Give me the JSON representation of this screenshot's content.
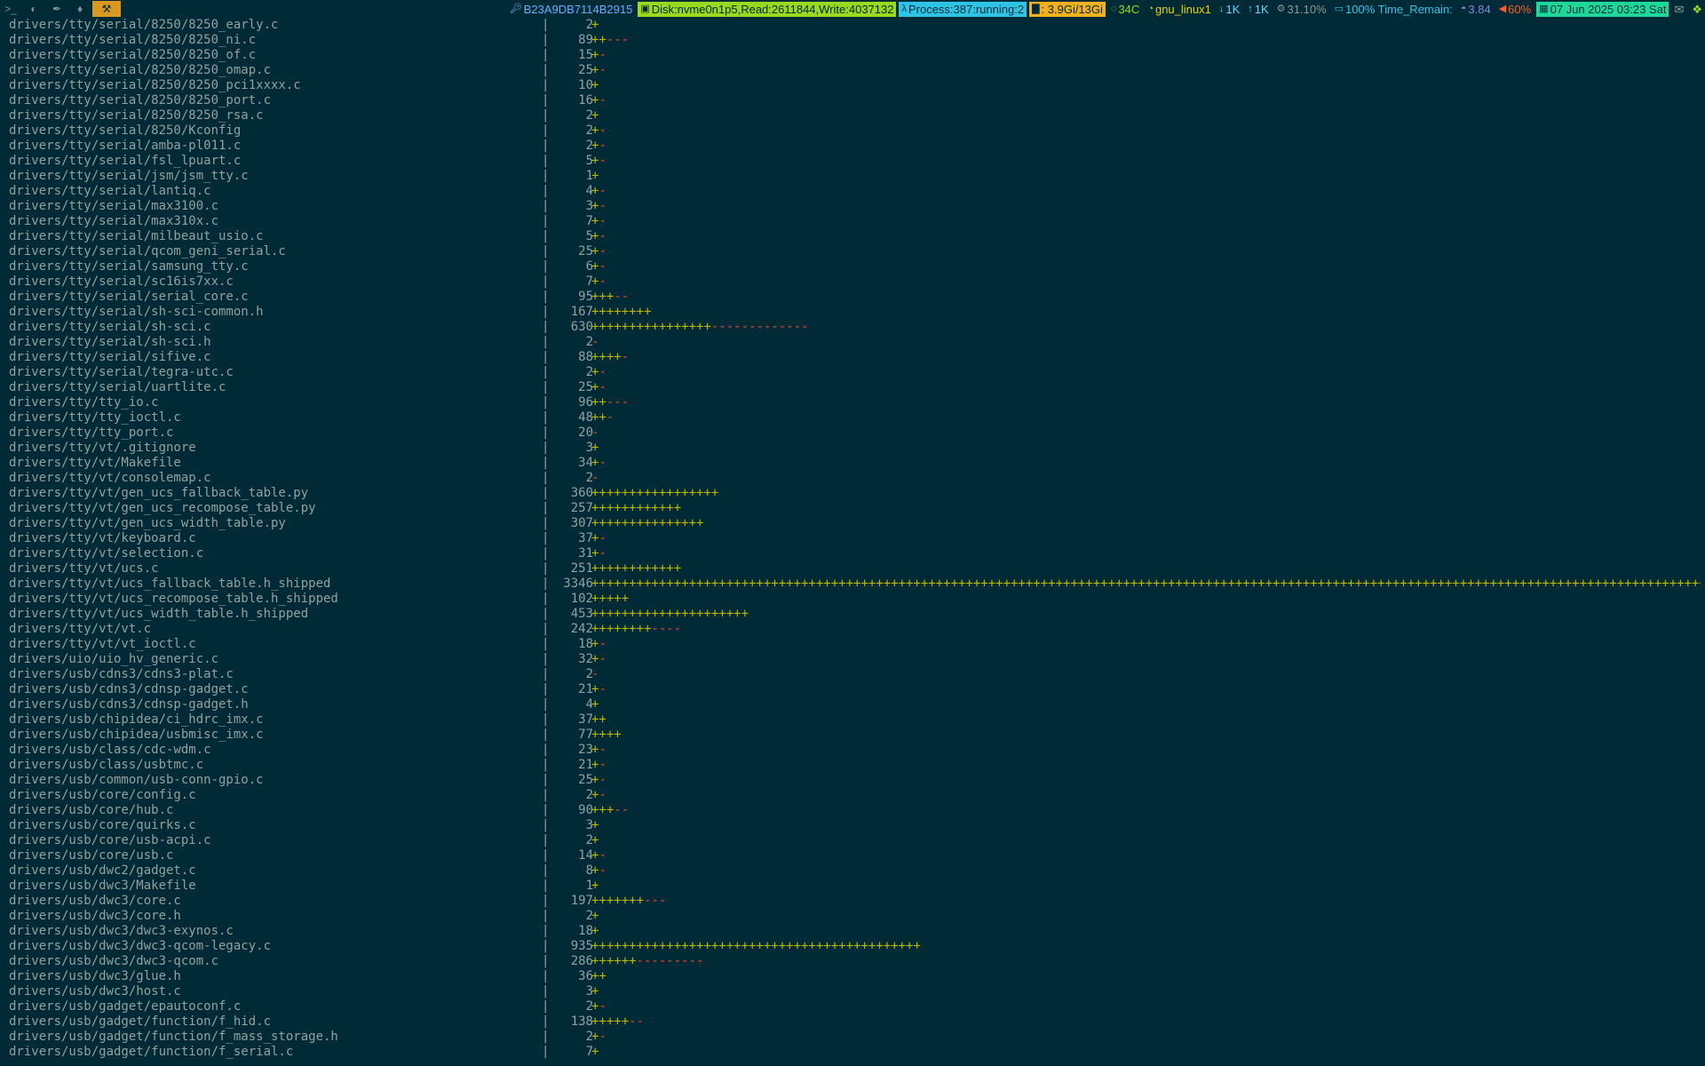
{
  "statusbar": {
    "workspaces": [
      {
        "name": "terminal-icon",
        "glyph": ">_"
      },
      {
        "name": "firefox-icon",
        "glyph": "◐"
      },
      {
        "name": "feather-icon",
        "glyph": "✒"
      },
      {
        "name": "penguin-icon",
        "glyph": "♦"
      },
      {
        "name": "tools-icon",
        "glyph": "⚒"
      }
    ],
    "host": "B23A9DB7114B2915",
    "disk": "Disk:nvme0n1p5,Read:2611844,Write:4037132",
    "process": "Process:387:running:2",
    "memory": ": 3.9Gi/13Gi",
    "temperature": "34C",
    "wifi": "gnu_linux1",
    "net_down": "1K",
    "net_up": "1K",
    "cpu": "31.10%",
    "battery": "100% Time_Remain:",
    "load": "3.84",
    "volume": "60%",
    "datetime": "07 Jun 2025 03:23 Sat",
    "colors": {
      "background": "#002b36",
      "active_workspace": "#d79921",
      "disk_bg": "#9ad91f",
      "process_bg": "#2ec4e6",
      "memory_bg": "#f2b01e",
      "date_bg": "#1cd99a"
    }
  },
  "diffstat": {
    "separator": "|",
    "colors": {
      "text": "#93a1a1",
      "plus": "#b9b900",
      "minus": "#e54b3a"
    },
    "rows": [
      {
        "file": "drivers/tty/serial/8250/8250_early.c",
        "count": "2",
        "plus": "+",
        "minus": ""
      },
      {
        "file": "drivers/tty/serial/8250/8250_ni.c",
        "count": "89",
        "plus": "++",
        "minus": "---"
      },
      {
        "file": "drivers/tty/serial/8250/8250_of.c",
        "count": "15",
        "plus": "+",
        "minus": "-"
      },
      {
        "file": "drivers/tty/serial/8250/8250_omap.c",
        "count": "25",
        "plus": "+",
        "minus": "-"
      },
      {
        "file": "drivers/tty/serial/8250/8250_pci1xxxx.c",
        "count": "10",
        "plus": "+",
        "minus": ""
      },
      {
        "file": "drivers/tty/serial/8250/8250_port.c",
        "count": "16",
        "plus": "+",
        "minus": "-"
      },
      {
        "file": "drivers/tty/serial/8250/8250_rsa.c",
        "count": "2",
        "plus": "+",
        "minus": ""
      },
      {
        "file": "drivers/tty/serial/8250/Kconfig",
        "count": "2",
        "plus": "+",
        "minus": "-"
      },
      {
        "file": "drivers/tty/serial/amba-pl011.c",
        "count": "2",
        "plus": "+",
        "minus": "-"
      },
      {
        "file": "drivers/tty/serial/fsl_lpuart.c",
        "count": "5",
        "plus": "+",
        "minus": "-"
      },
      {
        "file": "drivers/tty/serial/jsm/jsm_tty.c",
        "count": "1",
        "plus": "+",
        "minus": ""
      },
      {
        "file": "drivers/tty/serial/lantiq.c",
        "count": "4",
        "plus": "+",
        "minus": "-"
      },
      {
        "file": "drivers/tty/serial/max3100.c",
        "count": "3",
        "plus": "+",
        "minus": "-"
      },
      {
        "file": "drivers/tty/serial/max310x.c",
        "count": "7",
        "plus": "+",
        "minus": "-"
      },
      {
        "file": "drivers/tty/serial/milbeaut_usio.c",
        "count": "5",
        "plus": "+",
        "minus": "-"
      },
      {
        "file": "drivers/tty/serial/qcom_geni_serial.c",
        "count": "25",
        "plus": "+",
        "minus": "-"
      },
      {
        "file": "drivers/tty/serial/samsung_tty.c",
        "count": "6",
        "plus": "+",
        "minus": "-"
      },
      {
        "file": "drivers/tty/serial/sc16is7xx.c",
        "count": "7",
        "plus": "+",
        "minus": "-"
      },
      {
        "file": "drivers/tty/serial/serial_core.c",
        "count": "95",
        "plus": "+++",
        "minus": "--"
      },
      {
        "file": "drivers/tty/serial/sh-sci-common.h",
        "count": "167",
        "plus": "++++++++",
        "minus": ""
      },
      {
        "file": "drivers/tty/serial/sh-sci.c",
        "count": "630",
        "plus": "++++++++++++++++",
        "minus": "-------------"
      },
      {
        "file": "drivers/tty/serial/sh-sci.h",
        "count": "2",
        "plus": "",
        "minus": "-"
      },
      {
        "file": "drivers/tty/serial/sifive.c",
        "count": "88",
        "plus": "++++",
        "minus": "-"
      },
      {
        "file": "drivers/tty/serial/tegra-utc.c",
        "count": "2",
        "plus": "+",
        "minus": "-"
      },
      {
        "file": "drivers/tty/serial/uartlite.c",
        "count": "25",
        "plus": "+",
        "minus": "-"
      },
      {
        "file": "drivers/tty/tty_io.c",
        "count": "96",
        "plus": "++",
        "minus": "---"
      },
      {
        "file": "drivers/tty/tty_ioctl.c",
        "count": "48",
        "plus": "++",
        "minus": "-"
      },
      {
        "file": "drivers/tty/tty_port.c",
        "count": "20",
        "plus": "",
        "minus": "-"
      },
      {
        "file": "drivers/tty/vt/.gitignore",
        "count": "3",
        "plus": "+",
        "minus": ""
      },
      {
        "file": "drivers/tty/vt/Makefile",
        "count": "34",
        "plus": "+",
        "minus": "-"
      },
      {
        "file": "drivers/tty/vt/consolemap.c",
        "count": "2",
        "plus": "",
        "minus": "-"
      },
      {
        "file": "drivers/tty/vt/gen_ucs_fallback_table.py",
        "count": "360",
        "plus": "+++++++++++++++++",
        "minus": ""
      },
      {
        "file": "drivers/tty/vt/gen_ucs_recompose_table.py",
        "count": "257",
        "plus": "++++++++++++",
        "minus": ""
      },
      {
        "file": "drivers/tty/vt/gen_ucs_width_table.py",
        "count": "307",
        "plus": "+++++++++++++++",
        "minus": ""
      },
      {
        "file": "drivers/tty/vt/keyboard.c",
        "count": "37",
        "plus": "+",
        "minus": "-"
      },
      {
        "file": "drivers/tty/vt/selection.c",
        "count": "31",
        "plus": "+",
        "minus": "-"
      },
      {
        "file": "drivers/tty/vt/ucs.c",
        "count": "251",
        "plus": "++++++++++++",
        "minus": ""
      },
      {
        "file": "drivers/tty/vt/ucs_fallback_table.h_shipped",
        "count": "3346",
        "plus": "+++++++++++++++++++++++++++++++++++++++++++++++++++++++++++++++++++++++++++++++++++++++++++++++++++++++++++++++++++++++++++++++++++++++++++++++++++++++++++++",
        "minus": ""
      },
      {
        "file": "drivers/tty/vt/ucs_recompose_table.h_shipped",
        "count": "102",
        "plus": "+++++",
        "minus": ""
      },
      {
        "file": "drivers/tty/vt/ucs_width_table.h_shipped",
        "count": "453",
        "plus": "+++++++++++++++++++++",
        "minus": ""
      },
      {
        "file": "drivers/tty/vt/vt.c",
        "count": "242",
        "plus": "++++++++",
        "minus": "----"
      },
      {
        "file": "drivers/tty/vt/vt_ioctl.c",
        "count": "18",
        "plus": "+",
        "minus": "-"
      },
      {
        "file": "drivers/uio/uio_hv_generic.c",
        "count": "32",
        "plus": "+",
        "minus": "-"
      },
      {
        "file": "drivers/usb/cdns3/cdns3-plat.c",
        "count": "2",
        "plus": "",
        "minus": "-"
      },
      {
        "file": "drivers/usb/cdns3/cdnsp-gadget.c",
        "count": "21",
        "plus": "+",
        "minus": "-"
      },
      {
        "file": "drivers/usb/cdns3/cdnsp-gadget.h",
        "count": "4",
        "plus": "+",
        "minus": ""
      },
      {
        "file": "drivers/usb/chipidea/ci_hdrc_imx.c",
        "count": "37",
        "plus": "++",
        "minus": ""
      },
      {
        "file": "drivers/usb/chipidea/usbmisc_imx.c",
        "count": "77",
        "plus": "++++",
        "minus": ""
      },
      {
        "file": "drivers/usb/class/cdc-wdm.c",
        "count": "23",
        "plus": "+",
        "minus": "-"
      },
      {
        "file": "drivers/usb/class/usbtmc.c",
        "count": "21",
        "plus": "+",
        "minus": "-"
      },
      {
        "file": "drivers/usb/common/usb-conn-gpio.c",
        "count": "25",
        "plus": "+",
        "minus": "-"
      },
      {
        "file": "drivers/usb/core/config.c",
        "count": "2",
        "plus": "+",
        "minus": "-"
      },
      {
        "file": "drivers/usb/core/hub.c",
        "count": "90",
        "plus": "+++",
        "minus": "--"
      },
      {
        "file": "drivers/usb/core/quirks.c",
        "count": "3",
        "plus": "+",
        "minus": ""
      },
      {
        "file": "drivers/usb/core/usb-acpi.c",
        "count": "2",
        "plus": "+",
        "minus": ""
      },
      {
        "file": "drivers/usb/core/usb.c",
        "count": "14",
        "plus": "+",
        "minus": "-"
      },
      {
        "file": "drivers/usb/dwc2/gadget.c",
        "count": "8",
        "plus": "+",
        "minus": "-"
      },
      {
        "file": "drivers/usb/dwc3/Makefile",
        "count": "1",
        "plus": "+",
        "minus": ""
      },
      {
        "file": "drivers/usb/dwc3/core.c",
        "count": "197",
        "plus": "+++++++",
        "minus": "---"
      },
      {
        "file": "drivers/usb/dwc3/core.h",
        "count": "2",
        "plus": "+",
        "minus": ""
      },
      {
        "file": "drivers/usb/dwc3/dwc3-exynos.c",
        "count": "18",
        "plus": "+",
        "minus": ""
      },
      {
        "file": "drivers/usb/dwc3/dwc3-qcom-legacy.c",
        "count": "935",
        "plus": "++++++++++++++++++++++++++++++++++++++++++++",
        "minus": ""
      },
      {
        "file": "drivers/usb/dwc3/dwc3-qcom.c",
        "count": "286",
        "plus": "++++++",
        "minus": "---------"
      },
      {
        "file": "drivers/usb/dwc3/glue.h",
        "count": "36",
        "plus": "++",
        "minus": ""
      },
      {
        "file": "drivers/usb/dwc3/host.c",
        "count": "3",
        "plus": "+",
        "minus": ""
      },
      {
        "file": "drivers/usb/gadget/epautoconf.c",
        "count": "2",
        "plus": "+",
        "minus": "-"
      },
      {
        "file": "drivers/usb/gadget/function/f_hid.c",
        "count": "138",
        "plus": "+++++",
        "minus": "--"
      },
      {
        "file": "drivers/usb/gadget/function/f_mass_storage.h",
        "count": "2",
        "plus": "+",
        "minus": "-"
      },
      {
        "file": "drivers/usb/gadget/function/f_serial.c",
        "count": "7",
        "plus": "+",
        "minus": ""
      }
    ]
  }
}
